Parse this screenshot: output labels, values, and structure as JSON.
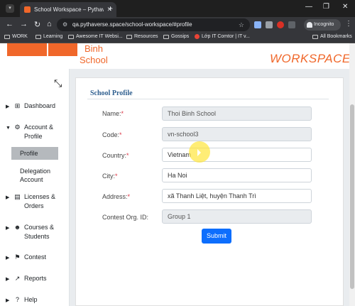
{
  "browser": {
    "tab_title": "School Workspace – Pythaverse",
    "tab_close": "✕",
    "new_tab": "+",
    "url": "qa.pythaverse.space/school-workspace/#profile",
    "incognito_label": "Incognito",
    "win_min": "—",
    "win_max": "❐",
    "win_close": "✕"
  },
  "bookmarks": [
    {
      "label": "WORK"
    },
    {
      "label": "Learning"
    },
    {
      "label": "Awesome IT Websi..."
    },
    {
      "label": "Resources"
    },
    {
      "label": "Gossips"
    },
    {
      "label": "Lớp IT Comtor | IT v..."
    }
  ],
  "all_bookmarks": "All Bookmarks",
  "header": {
    "logo_line1": "Binh",
    "logo_line2": "School",
    "workspace": "WORKSPACE",
    "brand_color": "#f0672a"
  },
  "sidebar": {
    "dashboard": "Dashboard",
    "account_profile": "Account &\nProfile",
    "profile": "Profile",
    "delegation": "Delegation Account",
    "licenses": "Licenses & Orders",
    "courses": "Courses & Students",
    "contest": "Contest",
    "reports": "Reports",
    "help": "Help"
  },
  "form": {
    "title": "School Profile",
    "name_label": "Name:",
    "name_value": "Thoi Binh School",
    "code_label": "Code:",
    "code_value": "vn-school3",
    "country_label": "Country:",
    "country_value": "Vietnam",
    "city_label": "City:",
    "city_value": "Ha Noi",
    "address_label": "Address:",
    "address_value": "xã Thanh Liệt, huyện Thanh Trì",
    "org_label": "Contest Org. ID:",
    "org_value": "Group 1",
    "required_mark": "*",
    "submit_label": "Submit",
    "submit_color": "#0d6efd"
  }
}
